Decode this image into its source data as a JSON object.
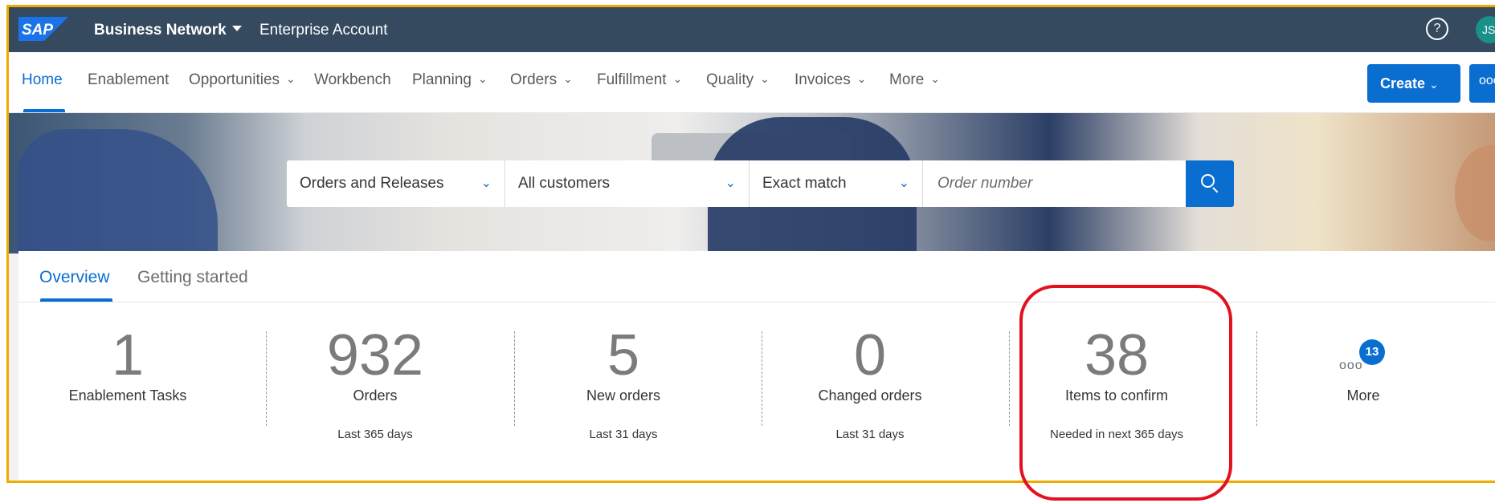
{
  "shell": {
    "logo": "SAP",
    "title": "Business Network",
    "subtitle": "Enterprise Account",
    "help_icon": "?",
    "avatar": "JS"
  },
  "nav": {
    "items": [
      {
        "label": "Home",
        "active": true
      },
      {
        "label": "Enablement"
      },
      {
        "label": "Opportunities",
        "chevron": true
      },
      {
        "label": "Workbench"
      },
      {
        "label": "Planning",
        "chevron": true
      },
      {
        "label": "Orders",
        "chevron": true
      },
      {
        "label": "Fulfillment",
        "chevron": true
      },
      {
        "label": "Quality",
        "chevron": true
      },
      {
        "label": "Invoices",
        "chevron": true
      },
      {
        "label": "More",
        "chevron": true
      }
    ],
    "create_label": "Create",
    "overflow_label": "ooo"
  },
  "search": {
    "document_type": "Orders and Releases",
    "customer": "All customers",
    "match_mode": "Exact match",
    "placeholder": "Order number"
  },
  "tabs": [
    {
      "label": "Overview",
      "active": true
    },
    {
      "label": "Getting started"
    }
  ],
  "tiles": [
    {
      "value": "1",
      "label": "Enablement Tasks",
      "sub": ""
    },
    {
      "value": "932",
      "label": "Orders",
      "sub": "Last 365 days"
    },
    {
      "value": "5",
      "label": "New orders",
      "sub": "Last 31 days"
    },
    {
      "value": "0",
      "label": "Changed orders",
      "sub": "Last 31 days"
    },
    {
      "value": "38",
      "label": "Items to confirm",
      "sub": "Needed in next 365 days"
    }
  ],
  "more_tile": {
    "dots": "ooo",
    "badge": "13",
    "label": "More"
  },
  "colors": {
    "shell": "#354a5f",
    "accent": "#0a6ed1",
    "highlight": "#e3101e",
    "frame": "#f0ab00"
  }
}
